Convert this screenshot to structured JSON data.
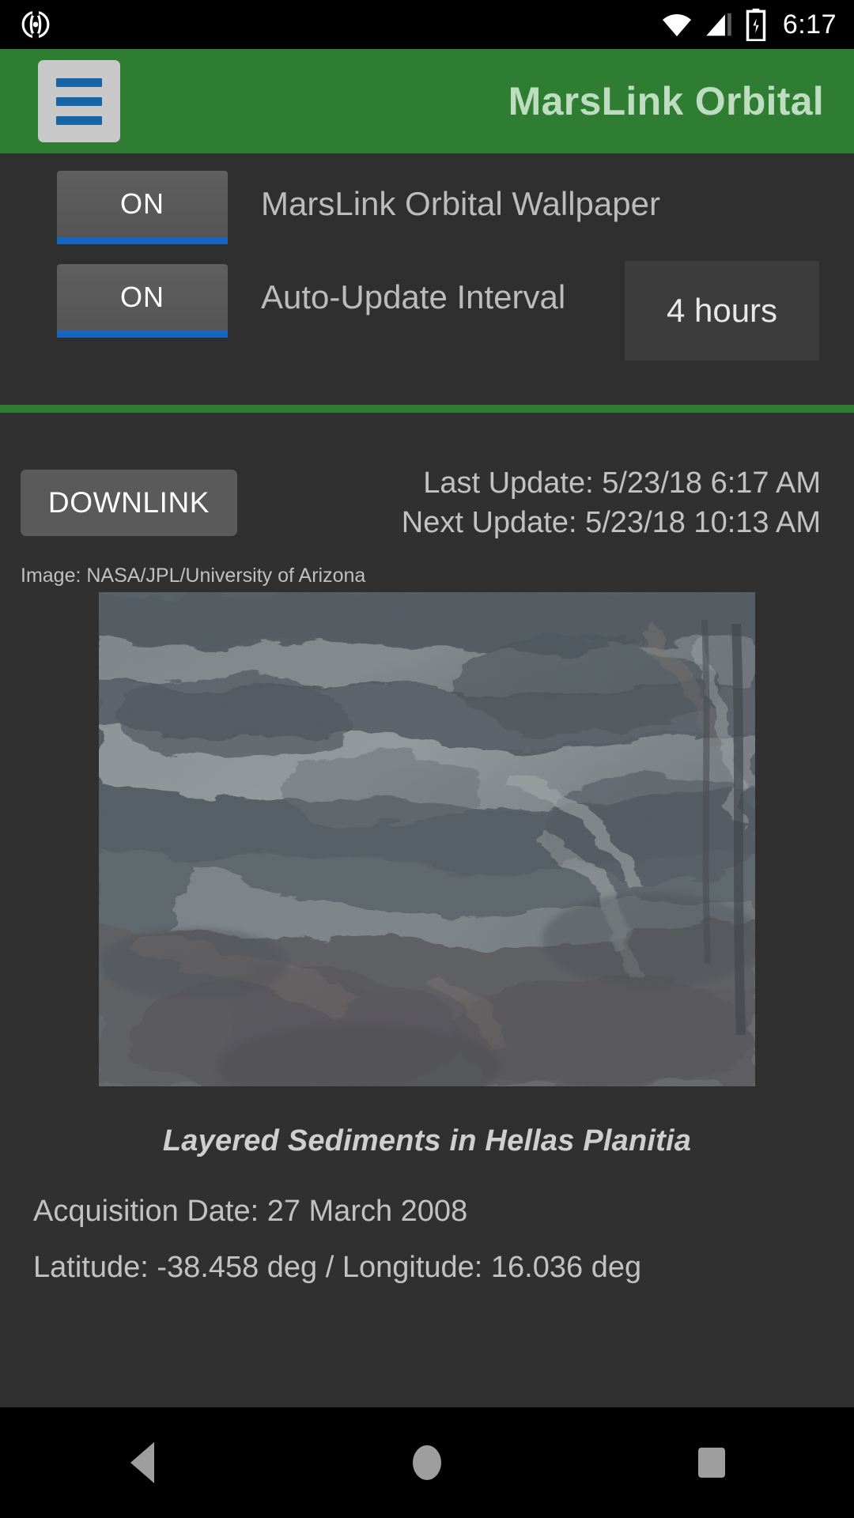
{
  "statusbar": {
    "time": "6:17",
    "icons": [
      "app-notification-icon",
      "wifi-icon",
      "cellular-signal-icon",
      "battery-charging-icon"
    ]
  },
  "appbar": {
    "title": "MarsLink Orbital",
    "menu_icon": "hamburger-menu-icon"
  },
  "settings": {
    "rows": [
      {
        "switch_label": "ON",
        "text": "MarsLink Orbital Wallpaper",
        "has_spinner": false
      },
      {
        "switch_label": "ON",
        "text": "Auto-Update Interval",
        "has_spinner": true,
        "spinner_value": "4 hours"
      }
    ]
  },
  "main": {
    "downlink_label": "DOWNLINK",
    "last_update": "Last Update: 5/23/18 6:17 AM",
    "next_update": "Next Update: 5/23/18 10:13 AM",
    "image_credit": "Image: NASA/JPL/University of Arizona",
    "caption": "Layered Sediments in Hellas Planitia",
    "acquisition_date": "Acquisition Date: 27 March 2008",
    "coordinates": "Latitude: -38.458 deg / Longitude: 16.036 deg"
  },
  "navbar": {
    "back": "back-button",
    "home": "home-button",
    "recents": "recents-button"
  },
  "colors": {
    "brand_green": "#2e7d33",
    "title_green": "#bedcc0",
    "accent_blue": "#1565c0",
    "panel_dark": "#2f2f2f",
    "content_dark": "#303030",
    "button_gray": "#5a5a5a",
    "menu_button": "#c8c8c8",
    "menu_bars_blue": "#1565a8"
  }
}
